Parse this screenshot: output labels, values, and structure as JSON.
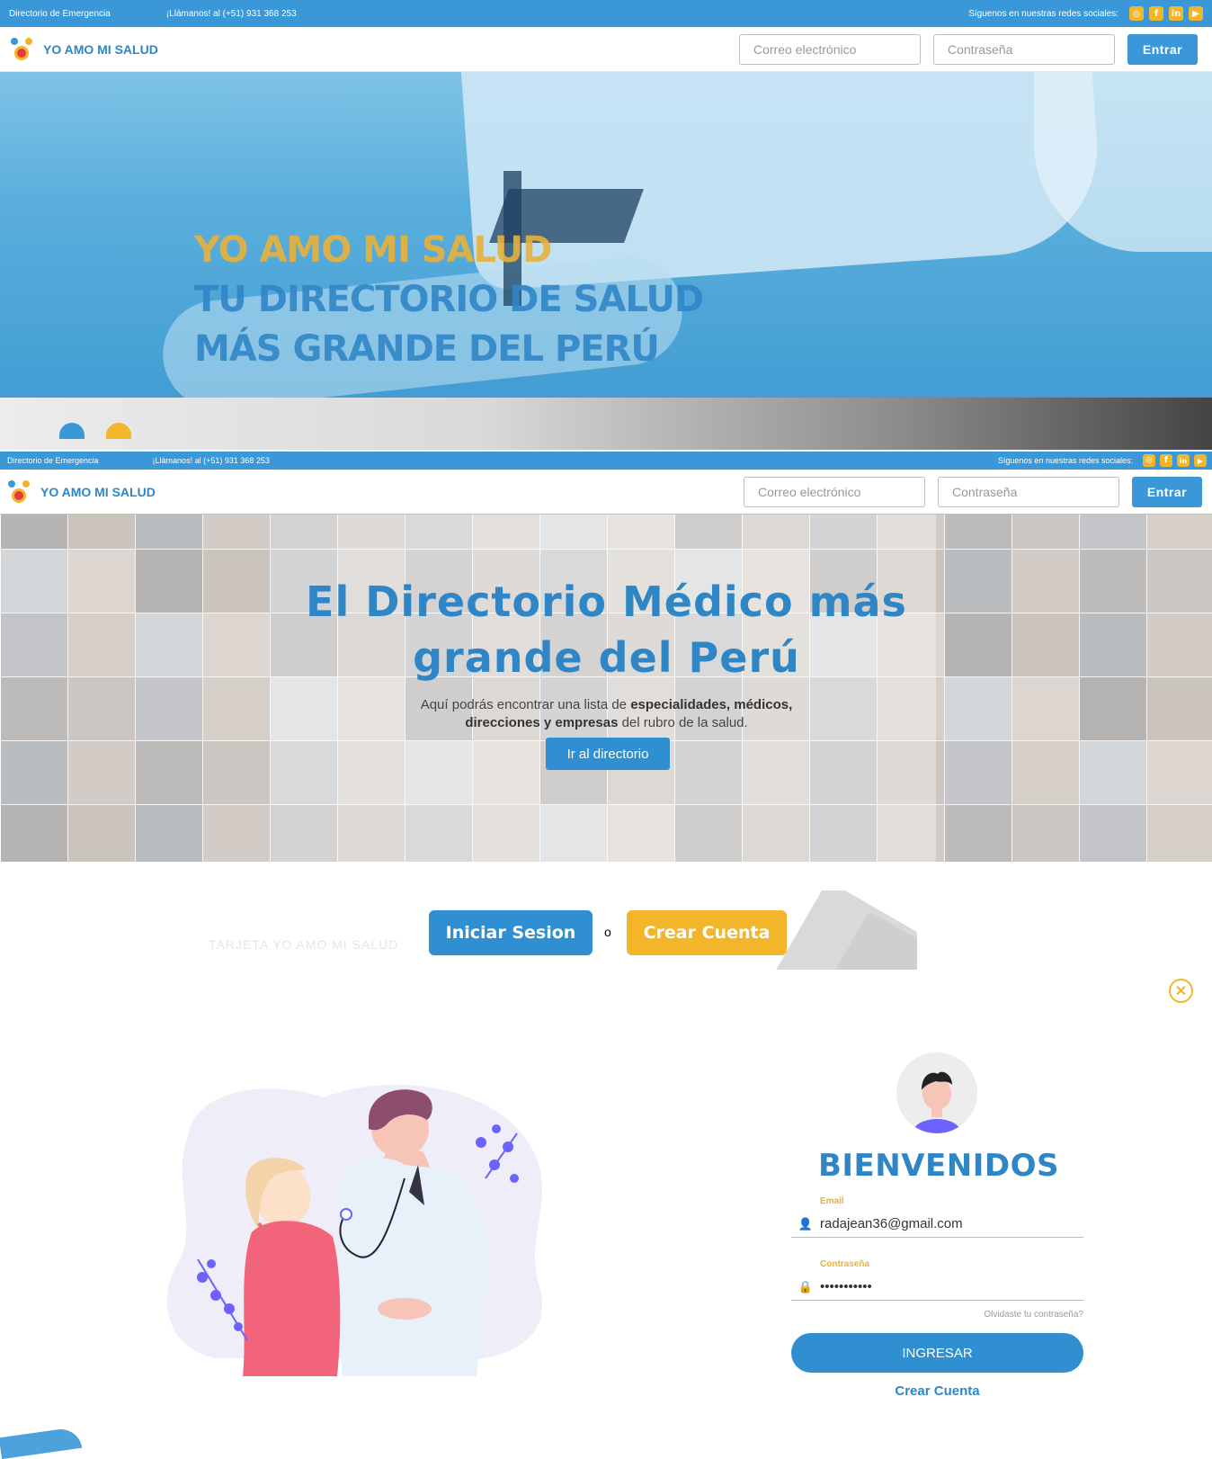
{
  "screen1": {
    "topbar": {
      "emergency": "Directorio de Emergencia",
      "phone": "¡Llámanos! al (+51) 931 368 253",
      "social_label": "Síguenos en nuestras redes sociales:"
    },
    "navbar": {
      "brand": "YO AMO MI SALUD",
      "email_placeholder": "Correo electrónico",
      "password_placeholder": "Contraseña",
      "login_button": "Entrar"
    },
    "hero": {
      "line1": "YO AMO MI SALUD",
      "line2": "TU DIRECTORIO DE SALUD",
      "line3": "MÁS GRANDE DEL PERÚ"
    }
  },
  "screen2": {
    "topbar": {
      "emergency": "Directorio de Emergencia",
      "phone": "¡Llámanos! al (+51) 931 368 253",
      "social_label": "Síguenos en nuestras redes sociales:"
    },
    "navbar": {
      "brand": "YO AMO MI SALUD",
      "email_placeholder": "Correo electrónico",
      "password_placeholder": "Contraseña",
      "login_button": "Entrar"
    },
    "hero": {
      "title_line1": "El Directorio Médico más",
      "title_line2": "grande del Perú",
      "sub_1": "Aquí podrás encontrar una lista de ",
      "sub_bold_1": "especialidades, médicos,",
      "sub_bold_2": "direcciones y empresas",
      "sub_2": " del rubro de la salud.",
      "button": "Ir al directorio"
    },
    "cta": {
      "ghost_text": "TARJETA YO AMO MI SALUD",
      "login": "Iniciar Sesion",
      "separator": "o",
      "register": "Crear Cuenta"
    },
    "login_card": {
      "title": "BIENVENIDOS",
      "email_label": "Email",
      "email_value": "radajean36@gmail.com",
      "password_label": "Contraseña",
      "password_value": "•••••••••••",
      "forgot": "Olvidaste tu contraseña?",
      "submit": "INGRESAR",
      "create": "Crear Cuenta"
    }
  },
  "colors": {
    "primary": "#3a98d8",
    "brand_blue": "#2f86c6",
    "accent_yellow": "#f3b52a"
  },
  "icons": [
    "instagram-icon",
    "facebook-icon",
    "linkedin-icon",
    "youtube-icon",
    "close-icon",
    "user-icon",
    "lock-icon"
  ]
}
